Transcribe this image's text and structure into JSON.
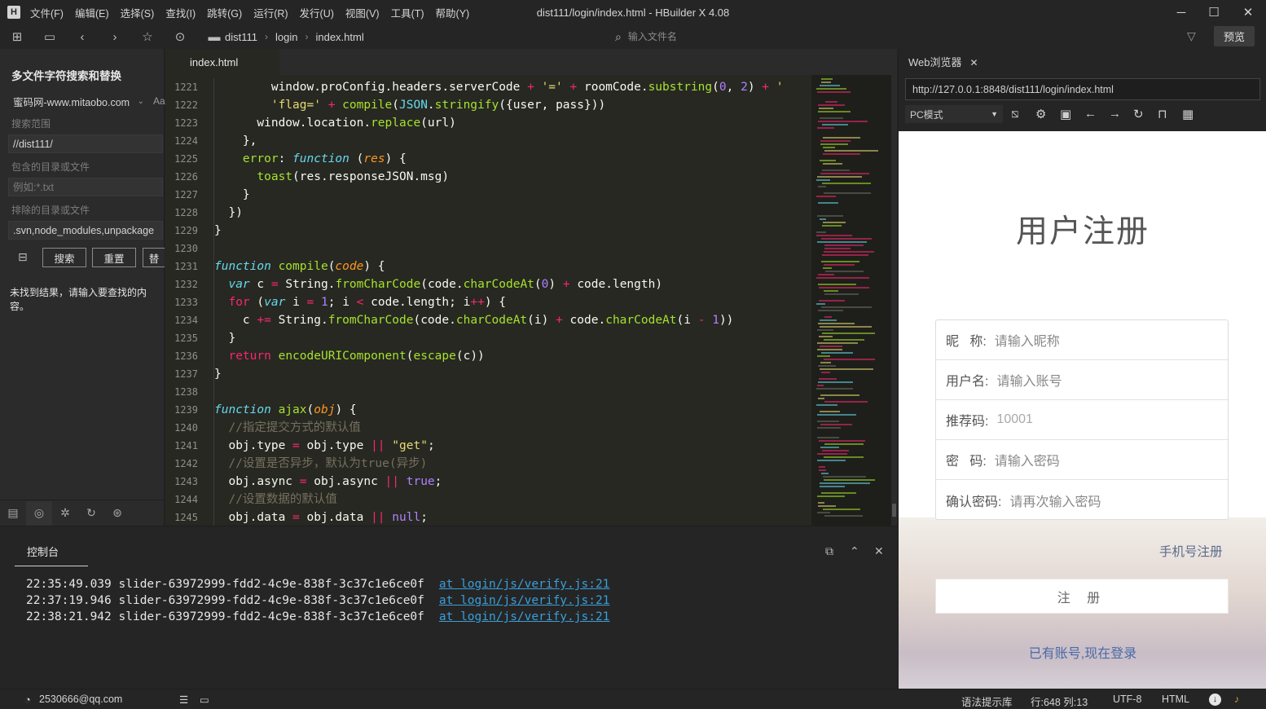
{
  "menu": [
    "文件(F)",
    "编辑(E)",
    "选择(S)",
    "查找(I)",
    "跳转(G)",
    "运行(R)",
    "发行(U)",
    "视图(V)",
    "工具(T)",
    "帮助(Y)"
  ],
  "window_title": "dist111/login/index.html - HBuilder X 4.08",
  "breadcrumb": [
    "dist111",
    "login",
    "index.html"
  ],
  "file_search_placeholder": "输入文件名",
  "preview_label": "预览",
  "left_panel": {
    "title": "多文件字符搜索和替换",
    "search_value": "蜜码网-www.mitaobo.com",
    "case_toggle": "Aa",
    "scope_label": "搜索范围",
    "scope_value": "//dist111/",
    "include_label": "包含的目录或文件",
    "include_placeholder": "例如:*.txt",
    "exclude_label": "排除的目录或文件",
    "exclude_value": ".svn,node_modules,unpackage",
    "search_btn": "搜索",
    "reset_btn": "重置",
    "replace_btn": "替",
    "result_text": "未找到结果，请输入要查找的内容。"
  },
  "editor": {
    "tab": "index.html",
    "line_numbers": [
      "1221",
      "1222",
      "1223",
      "1224",
      "1225",
      "1226",
      "1227",
      "1228",
      "1229",
      "1230",
      "1231",
      "1232",
      "1233",
      "1234",
      "1235",
      "1236",
      "1237",
      "1238",
      "1239",
      "1240",
      "1241",
      "1242",
      "1243",
      "1244",
      "1245"
    ]
  },
  "console": {
    "tab": "控制台",
    "lines": [
      {
        "time": "22:35:49.039",
        "msg": "slider-63972999-fdd2-4c9e-838f-3c37c1e6ce0f",
        "link": "at login/js/verify.js:21"
      },
      {
        "time": "22:37:19.946",
        "msg": "slider-63972999-fdd2-4c9e-838f-3c37c1e6ce0f",
        "link": "at login/js/verify.js:21"
      },
      {
        "time": "22:38:21.942",
        "msg": "slider-63972999-fdd2-4c9e-838f-3c37c1e6ce0f",
        "link": "at login/js/verify.js:21"
      }
    ]
  },
  "browser": {
    "tab": "Web浏览器",
    "url": "http://127.0.0.1:8848/dist111/login/index.html",
    "mode": "PC模式",
    "page": {
      "title": "用户注册",
      "fields": [
        {
          "label": "昵   称:",
          "placeholder": "请输入昵称"
        },
        {
          "label": "用户名:",
          "placeholder": "请输入账号"
        },
        {
          "label": "推荐码:",
          "placeholder": "10001"
        },
        {
          "label": "密   码:",
          "placeholder": "请输入密码"
        },
        {
          "label": "确认密码:",
          "placeholder": "请再次输入密码"
        }
      ],
      "phone_register": "手机号注册",
      "submit": "注 册",
      "login_link": "已有账号,现在登录"
    }
  },
  "status": {
    "user": "2530666@qq.com",
    "syntax": "语法提示库",
    "position": "行:648  列:13",
    "encoding": "UTF-8",
    "language": "HTML"
  },
  "colors": {
    "editor_bg": "#272822",
    "keyword": "#f92672",
    "function": "#a6e22e",
    "string": "#e6db74",
    "number": "#ae81ff",
    "link": "#3a9fd8"
  }
}
